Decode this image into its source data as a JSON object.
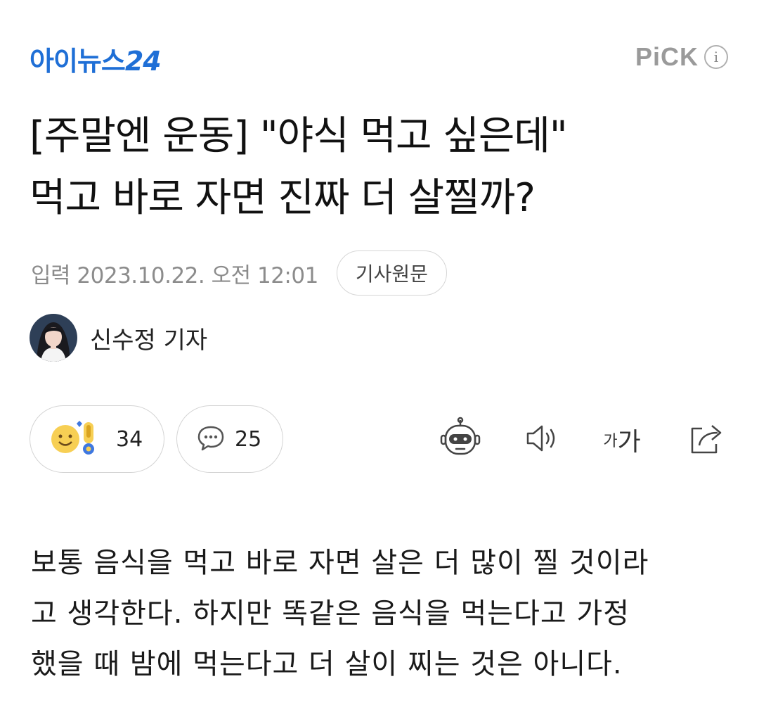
{
  "header": {
    "logo_text": "아이뉴스",
    "logo_number": "24",
    "pick_label": "PiCK",
    "info_icon": "i"
  },
  "article": {
    "title_lines": [
      "[주말엔 운동] \"야식 먹고 싶은데\"",
      "먹고 바로 자면 진짜 더 살찔까?"
    ],
    "date": "입력 2023.10.22. 오전 12:01",
    "original_button": "기사원문",
    "reporter": "신수정 기자",
    "body_lines": [
      "보통 음식을 먹고 바로 자면 살은 더 많이 찔 것이라",
      "고 생각한다. 하지만 똑같은 음식을 먹는다고 가정",
      "했을 때 밤에 먹는다고 더 살이 찌는 것은 아니다."
    ]
  },
  "actions": {
    "reaction_count": "34",
    "comment_count": "25",
    "font_size_small": "가",
    "font_size_big": "가"
  },
  "colors": {
    "brand": "#1f6fd6",
    "muted": "#8c8c8c",
    "border": "#d4d4d4"
  },
  "icons": [
    "reaction-emoji-icon",
    "comment-bubble-icon",
    "summary-bot-icon",
    "speaker-icon",
    "font-size-icon",
    "share-icon",
    "info-icon"
  ]
}
